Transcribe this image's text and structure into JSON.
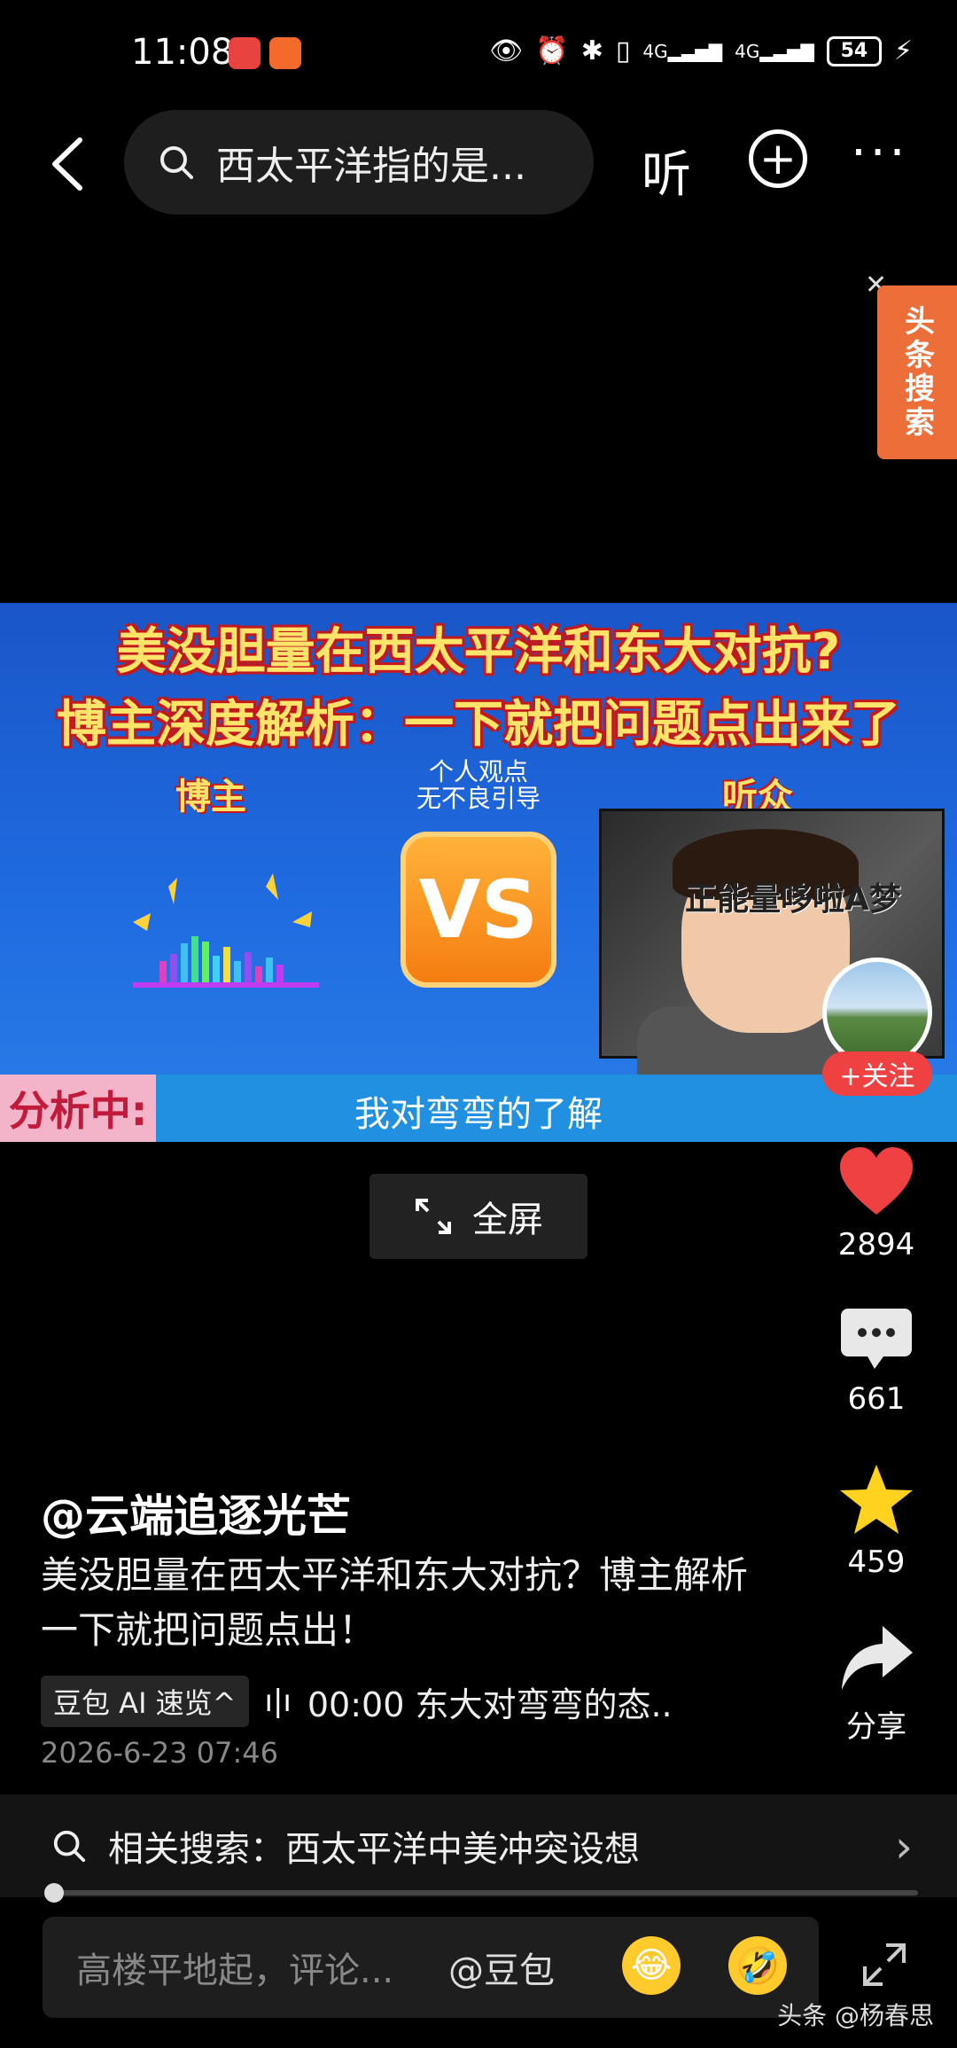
{
  "status_bar": {
    "time": "11:08",
    "battery": "54",
    "network1": "4G",
    "network2": "4G"
  },
  "top_nav": {
    "search_text": "西太平洋指的是...",
    "listen_label": "听"
  },
  "side_ad": {
    "label": "头条搜索"
  },
  "video": {
    "title_line1": "美没胆量在西太平洋和东大对抗?",
    "title_line2": "博主深度解析：一下就把问题点出来了",
    "label_left": "博主",
    "label_right": "听众",
    "opinion_line1": "个人观点",
    "opinion_line2": "无不良引导",
    "vs_text": "VS",
    "audience_caption": "正能量哆啦A梦",
    "analysis_tag": "分析中:",
    "subtitle": "我对弯弯的了解",
    "follow_label": "+关注"
  },
  "fullscreen": {
    "label": "全屏"
  },
  "actions": {
    "like_count": "2894",
    "comment_count": "661",
    "favorite_count": "459",
    "share_label": "分享"
  },
  "post": {
    "author": "@云端追逐光芒",
    "desc": "美没胆量在西太平洋和东大对抗？博主解析一下就把问题点出！",
    "ai_chip": "豆包 AI 速览^",
    "ai_summary": "00:00 东大对弯弯的态..",
    "date": "2026-6-23 07:46"
  },
  "related_search": {
    "label": "相关搜索：西太平洋中美冲突设想"
  },
  "comment_bar": {
    "placeholder": "高楼平地起，评论...",
    "mention": "@豆包"
  },
  "watermark": "头条 @杨春思",
  "colors": {
    "accent_red": "#f04142",
    "ad_orange": "#ec6f3a",
    "video_blue": "#1f6be0",
    "star_yellow": "#ffd21f"
  }
}
